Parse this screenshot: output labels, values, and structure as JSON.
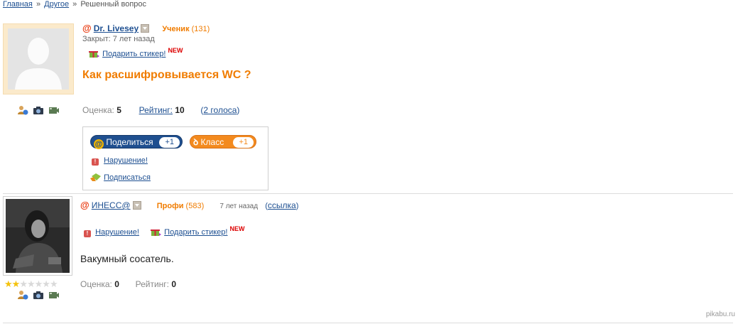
{
  "breadcrumb": {
    "home": "Главная",
    "category": "Другое",
    "current": "Решенный вопрос",
    "separator": "»"
  },
  "question": {
    "author": {
      "at_symbol": "@",
      "name": "Dr. Livesey",
      "rank": "Ученик",
      "points": "(131)"
    },
    "closed_text": "Закрыт: 7 лет назад",
    "gift_label": "Подарить стикер!",
    "new_badge": "NEW",
    "title": "Как расшифровывается WC ?",
    "stats": {
      "score_label": "Оценка:",
      "score": "5",
      "rating_label": "Рейтинг:",
      "rating": "10",
      "votes": "2 голоса"
    },
    "share": {
      "mail_label": "Поделиться",
      "mail_count": "+1",
      "ok_label": "Класс",
      "ok_count": "+1",
      "report_label": "Нарушение!",
      "subscribe_label": "Подписаться"
    }
  },
  "answer": {
    "author": {
      "at_symbol": "@",
      "name": "ИНЕСС@",
      "rank": "Профи",
      "points": "(583)"
    },
    "time": "7 лет назад",
    "link_label": "ссылка",
    "report_label": "Нарушение!",
    "gift_label": "Подарить стикер!",
    "new_badge": "NEW",
    "text": "Вакумный сосатель.",
    "stats": {
      "score_label": "Оценка:",
      "score": "0",
      "rating_label": "Рейтинг:",
      "rating": "0"
    },
    "stars_filled": 2,
    "stars_total": 7
  },
  "watermark": "pikabu.ru",
  "icons": [
    "contact-icon",
    "camera-icon",
    "video-icon",
    "gift-icon",
    "warning-icon",
    "subscribe-icon"
  ],
  "colors": {
    "accent_orange": "#f07c00",
    "link_blue": "#1d4f91",
    "mail_blue": "#1f4f8f",
    "ok_orange": "#f38a1e"
  }
}
